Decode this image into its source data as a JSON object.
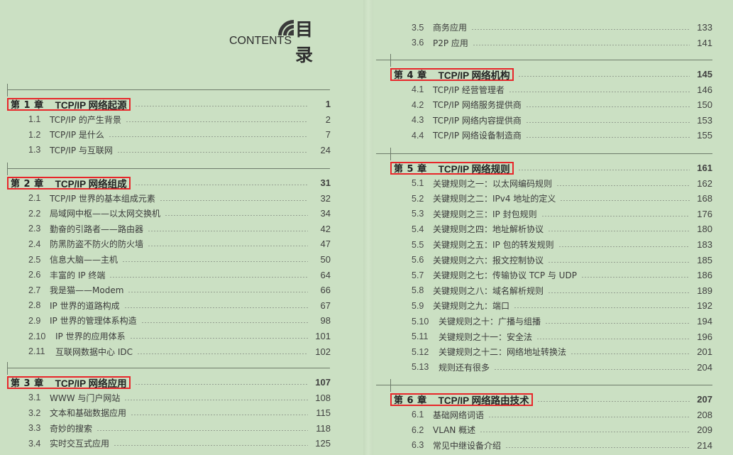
{
  "header": {
    "title_cn": "目录",
    "title_en": "CONTENTS"
  },
  "colors": {
    "background": "#cbe0c3",
    "highlight_box": "#e8262a"
  },
  "left_column": {
    "chapters": [
      {
        "number_label": "第 1 章",
        "title": "TCP/IP 网络起源",
        "page": "1",
        "sections": [
          {
            "num": "1.1",
            "title": "TCP/IP 的产生背景",
            "page": "2"
          },
          {
            "num": "1.2",
            "title": "TCP/IP 是什么",
            "page": "7"
          },
          {
            "num": "1.3",
            "title": "TCP/IP 与互联网",
            "page": "24"
          }
        ]
      },
      {
        "number_label": "第 2 章",
        "title": "TCP/IP 网络组成",
        "page": "31",
        "sections": [
          {
            "num": "2.1",
            "title": "TCP/IP 世界的基本组成元素",
            "page": "32"
          },
          {
            "num": "2.2",
            "title": "局域网中枢——以太网交换机",
            "page": "34"
          },
          {
            "num": "2.3",
            "title": "勤奋的引路者——路由器",
            "page": "42"
          },
          {
            "num": "2.4",
            "title": "防黑防盗不防火的防火墙",
            "page": "47"
          },
          {
            "num": "2.5",
            "title": "信息大脑——主机",
            "page": "50"
          },
          {
            "num": "2.6",
            "title": "丰富的 IP 终端",
            "page": "64"
          },
          {
            "num": "2.7",
            "title": "我是猫——Modem",
            "page": "66"
          },
          {
            "num": "2.8",
            "title": "IP 世界的道路构成",
            "page": "67"
          },
          {
            "num": "2.9",
            "title": "IP 世界的管理体系构造",
            "page": "98"
          },
          {
            "num": "2.10",
            "title": "IP 世界的应用体系",
            "page": "101"
          },
          {
            "num": "2.11",
            "title": "互联网数据中心 IDC",
            "page": "102"
          }
        ]
      },
      {
        "number_label": "第 3 章",
        "title": "TCP/IP 网络应用",
        "page": "107",
        "sections": [
          {
            "num": "3.1",
            "title": "WWW 与门户网站",
            "page": "108"
          },
          {
            "num": "3.2",
            "title": "文本和基础数据应用",
            "page": "115"
          },
          {
            "num": "3.3",
            "title": "奇妙的搜索",
            "page": "118"
          },
          {
            "num": "3.4",
            "title": "实时交互式应用",
            "page": "125"
          }
        ]
      }
    ]
  },
  "right_column": {
    "continued_sections": [
      {
        "num": "3.5",
        "title": "商务应用",
        "page": "133"
      },
      {
        "num": "3.6",
        "title": "P2P 应用",
        "page": "141"
      }
    ],
    "chapters": [
      {
        "number_label": "第 4 章",
        "title": "TCP/IP 网络机构",
        "page": "145",
        "sections": [
          {
            "num": "4.1",
            "title": "TCP/IP 经营管理者",
            "page": "146"
          },
          {
            "num": "4.2",
            "title": "TCP/IP 网络服务提供商",
            "page": "150"
          },
          {
            "num": "4.3",
            "title": "TCP/IP 网络内容提供商",
            "page": "153"
          },
          {
            "num": "4.4",
            "title": "TCP/IP 网络设备制造商",
            "page": "155"
          }
        ]
      },
      {
        "number_label": "第 5 章",
        "title": "TCP/IP 网络规则",
        "page": "161",
        "sections": [
          {
            "num": "5.1",
            "title": "关键规则之一：以太网编码规则",
            "page": "162"
          },
          {
            "num": "5.2",
            "title": "关键规则之二：IPv4 地址的定义",
            "page": "168"
          },
          {
            "num": "5.3",
            "title": "关键规则之三：IP 封包规则",
            "page": "176"
          },
          {
            "num": "5.4",
            "title": "关键规则之四：地址解析协议",
            "page": "180"
          },
          {
            "num": "5.5",
            "title": "关键规则之五：IP 包的转发规则",
            "page": "183"
          },
          {
            "num": "5.6",
            "title": "关键规则之六：报文控制协议",
            "page": "185"
          },
          {
            "num": "5.7",
            "title": "关键规则之七：传输协议 TCP 与 UDP",
            "page": "186"
          },
          {
            "num": "5.8",
            "title": "关键规则之八：域名解析规则",
            "page": "189"
          },
          {
            "num": "5.9",
            "title": "关键规则之九：端口",
            "page": "192"
          },
          {
            "num": "5.10",
            "title": "关键规则之十：广播与组播",
            "page": "194"
          },
          {
            "num": "5.11",
            "title": "关键规则之十一：安全法",
            "page": "196"
          },
          {
            "num": "5.12",
            "title": "关键规则之十二：网络地址转换法",
            "page": "201"
          },
          {
            "num": "5.13",
            "title": "规则还有很多",
            "page": "204"
          }
        ]
      },
      {
        "number_label": "第 6 章",
        "title": "TCP/IP 网络路由技术",
        "page": "207",
        "sections": [
          {
            "num": "6.1",
            "title": "基础网络词语",
            "page": "208"
          },
          {
            "num": "6.2",
            "title": "VLAN 概述",
            "page": "209"
          },
          {
            "num": "6.3",
            "title": "常见中继设备介绍",
            "page": "214"
          }
        ]
      }
    ]
  }
}
